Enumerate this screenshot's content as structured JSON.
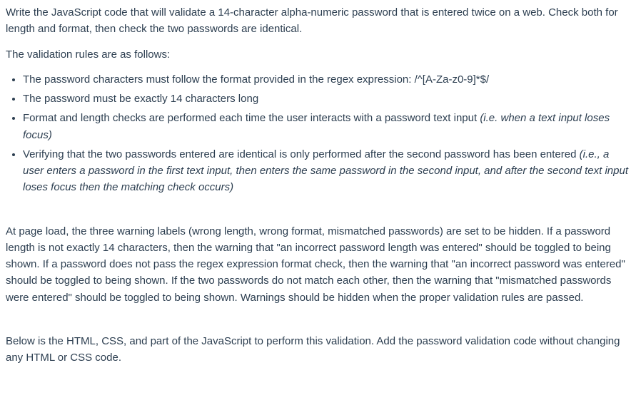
{
  "p1": "Write the JavaScript code that will validate a 14-character alpha-numeric password that is entered twice on a web. Check both for length and format, then check the two passwords are identical.",
  "p2": "The validation rules are as follows:",
  "bullets": {
    "b1": " The password characters must follow the format provided in the regex expression: /^[A-Za-z0-9]*$/",
    "b2": "The password must be exactly 14 characters long",
    "b3_a": "Format and length checks are performed each time the user interacts with a password text input ",
    "b3_i": "(i.e. when a text input loses focus)",
    "b4_a": " Verifying that the two passwords entered are identical is only performed after the second password has been entered ",
    "b4_i": "(i.e., a user enters a password in the first text input, then enters the same password in the second input, and after the second text input loses focus then the matching check occurs)"
  },
  "p3": "At page load, the three warning labels (wrong length, wrong format, mismatched passwords) are set to be hidden. If a password length is not exactly 14 characters, then the warning that \"an incorrect password length was entered\" should be toggled to being shown. If a password does not pass the regex expression format check, then the warning that \"an incorrect password was entered\" should be toggled to being shown. If the two passwords do not match each other, then the warning that \"mismatched passwords were entered\" should be toggled to being shown. Warnings should be hidden when the proper validation rules are passed.",
  "p4": "Below is the HTML, CSS, and part of the JavaScript to perform this validation. Add the password validation code without changing any HTML or CSS code."
}
